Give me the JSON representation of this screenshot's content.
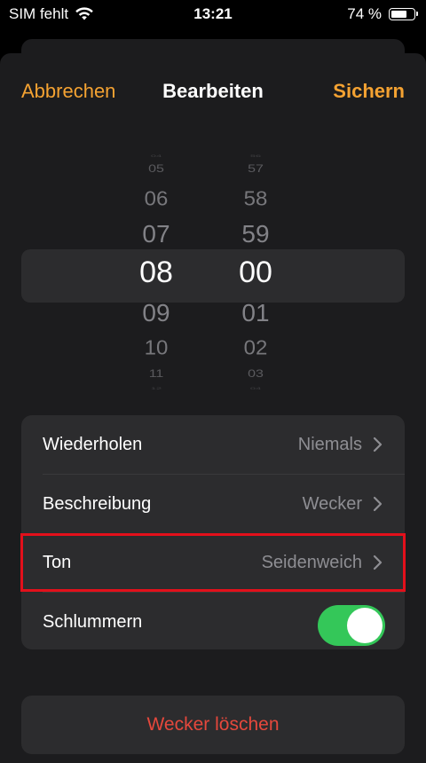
{
  "status_bar": {
    "carrier": "SIM fehlt",
    "time": "13:21",
    "battery": "74 %",
    "battery_level": 0.74
  },
  "nav": {
    "cancel_label": "Abbrechen",
    "title": "Bearbeiten",
    "save_label": "Sichern"
  },
  "picker": {
    "hours": [
      "04",
      "05",
      "06",
      "07",
      "08",
      "09",
      "10",
      "11",
      "12"
    ],
    "minutes": [
      "56",
      "57",
      "58",
      "59",
      "00",
      "01",
      "02",
      "03",
      "04"
    ],
    "selected_hour": "08",
    "selected_minute": "00"
  },
  "settings": {
    "repeat": {
      "label": "Wiederholen",
      "value": "Niemals"
    },
    "description": {
      "label": "Beschreibung",
      "value": "Wecker"
    },
    "sound": {
      "label": "Ton",
      "value": "Seidenweich"
    },
    "snooze": {
      "label": "Schlummern",
      "on": true
    }
  },
  "delete_label": "Wecker löschen",
  "colors": {
    "accent": "#f4a232",
    "toggle_on": "#34c759",
    "destructive": "#e5483c",
    "highlight": "#e3101b"
  }
}
